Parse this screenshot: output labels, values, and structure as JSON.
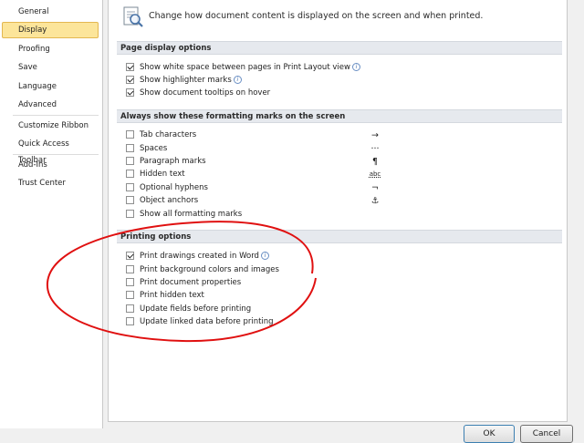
{
  "nav": {
    "items": [
      {
        "label": "General",
        "selected": false
      },
      {
        "label": "Display",
        "selected": true
      },
      {
        "label": "Proofing",
        "selected": false
      },
      {
        "label": "Save",
        "selected": false
      },
      {
        "label": "Language",
        "selected": false
      },
      {
        "label": "Advanced",
        "selected": false
      },
      {
        "label": "Customize Ribbon",
        "selected": false
      },
      {
        "label": "Quick Access Toolbar",
        "selected": false
      },
      {
        "label": "Add-Ins",
        "selected": false
      },
      {
        "label": "Trust Center",
        "selected": false
      }
    ]
  },
  "header": {
    "icon": "display-settings-icon",
    "text": "Change how document content is displayed on the screen and when printed."
  },
  "page_display": {
    "title": "Page display options",
    "options": [
      {
        "label": "Show white space between pages in Print Layout view",
        "checked": true,
        "info": true
      },
      {
        "label": "Show highlighter marks",
        "checked": true,
        "info": true
      },
      {
        "label": "Show document tooltips on hover",
        "checked": true,
        "info": false
      }
    ]
  },
  "formatting_marks": {
    "title": "Always show these formatting marks on the screen",
    "options": [
      {
        "label": "Tab characters",
        "checked": false,
        "symbol": "→"
      },
      {
        "label": "Spaces",
        "checked": false,
        "symbol": "···"
      },
      {
        "label": "Paragraph marks",
        "checked": false,
        "symbol": "¶"
      },
      {
        "label": "Hidden text",
        "checked": false,
        "symbol": "abc"
      },
      {
        "label": "Optional hyphens",
        "checked": false,
        "symbol": "¬"
      },
      {
        "label": "Object anchors",
        "checked": false,
        "symbol": "⚓"
      },
      {
        "label": "Show all formatting marks",
        "checked": false,
        "symbol": ""
      }
    ]
  },
  "printing": {
    "title": "Printing options",
    "options": [
      {
        "label": "Print drawings created in Word",
        "checked": true,
        "info": true
      },
      {
        "label": "Print background colors and images",
        "checked": false,
        "info": false
      },
      {
        "label": "Print document properties",
        "checked": false,
        "info": false
      },
      {
        "label": "Print hidden text",
        "checked": false,
        "info": false
      },
      {
        "label": "Update fields before printing",
        "checked": false,
        "info": false
      },
      {
        "label": "Update linked data before printing",
        "checked": false,
        "info": false
      }
    ]
  },
  "buttons": {
    "ok": "OK",
    "cancel": "Cancel"
  },
  "colors": {
    "selection": "#fce59a",
    "annotation": "#e01010",
    "section_header": "#e6e9ee"
  }
}
